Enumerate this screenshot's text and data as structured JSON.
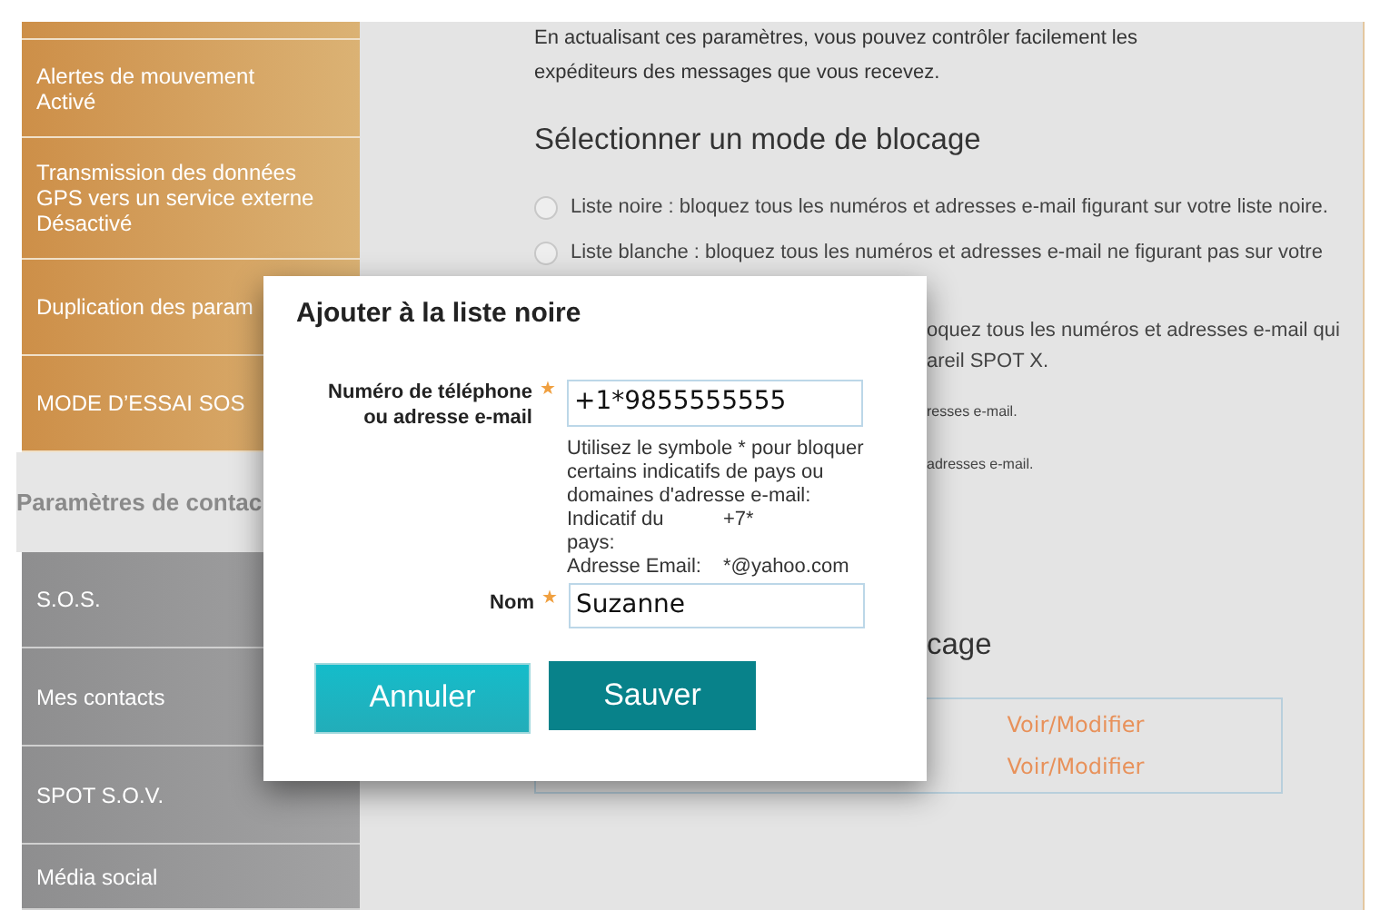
{
  "sidebar": {
    "top_items": [
      {
        "title": "Alertes de mouvement",
        "status": "Activé"
      },
      {
        "title": "Transmission des données",
        "title_2": "GPS vers un service externe",
        "status": "Désactivé"
      },
      {
        "title": "Duplication des param"
      },
      {
        "title": "MODE D’ESSAI SOS"
      }
    ],
    "section_header": "Paramètres de contac",
    "items": [
      {
        "label": "S.O.S."
      },
      {
        "label": "Mes contacts"
      },
      {
        "label": "SPOT S.O.V."
      },
      {
        "label": "Média social"
      }
    ]
  },
  "intro": [
    "En actualisant ces paramètres, vous pouvez contrôler facilement les",
    "expéditeurs des messages que vous recevez."
  ],
  "heading": "Sélectionner un mode de blocage",
  "radios": [
    {
      "label": "Liste noire : bloquez tous les numéros et adresses e-mail figurant sur votre liste noire.",
      "selected": false
    },
    {
      "label": "Liste blanche : bloquez tous les numéros et adresses e-mail ne figurant pas sur votre",
      "selected": false
    }
  ],
  "partial_lines": [
    "oquez tous les numéros et adresses e-mail qui",
    "areil SPOT X."
  ],
  "small_lines": [
    "resses e-mail.",
    "adresses e-mail."
  ],
  "heading_2": "cage",
  "links": [
    "Voir/Modifier",
    "Voir/Modifier"
  ],
  "dialog": {
    "title": "Ajouter à la liste noire",
    "fields": [
      {
        "label": "Numéro de téléphone ou adresse e-mail",
        "required_mark": "★",
        "value": "+1*9855555555"
      },
      {
        "label": "Nom",
        "required_mark": "★",
        "value": "Suzanne"
      }
    ],
    "hint": "Utilisez le symbole * pour bloquer certains indicatifs de pays ou domaines d'adresse e-mail:",
    "examples": [
      {
        "label": "Indicatif du pays:",
        "value": "+7*"
      },
      {
        "label": "Adresse Email:",
        "value": "*@yahoo.com"
      }
    ],
    "buttons": [
      {
        "label": "Annuler",
        "kind": "cancel"
      },
      {
        "label": "Sauver",
        "kind": "save"
      }
    ]
  }
}
